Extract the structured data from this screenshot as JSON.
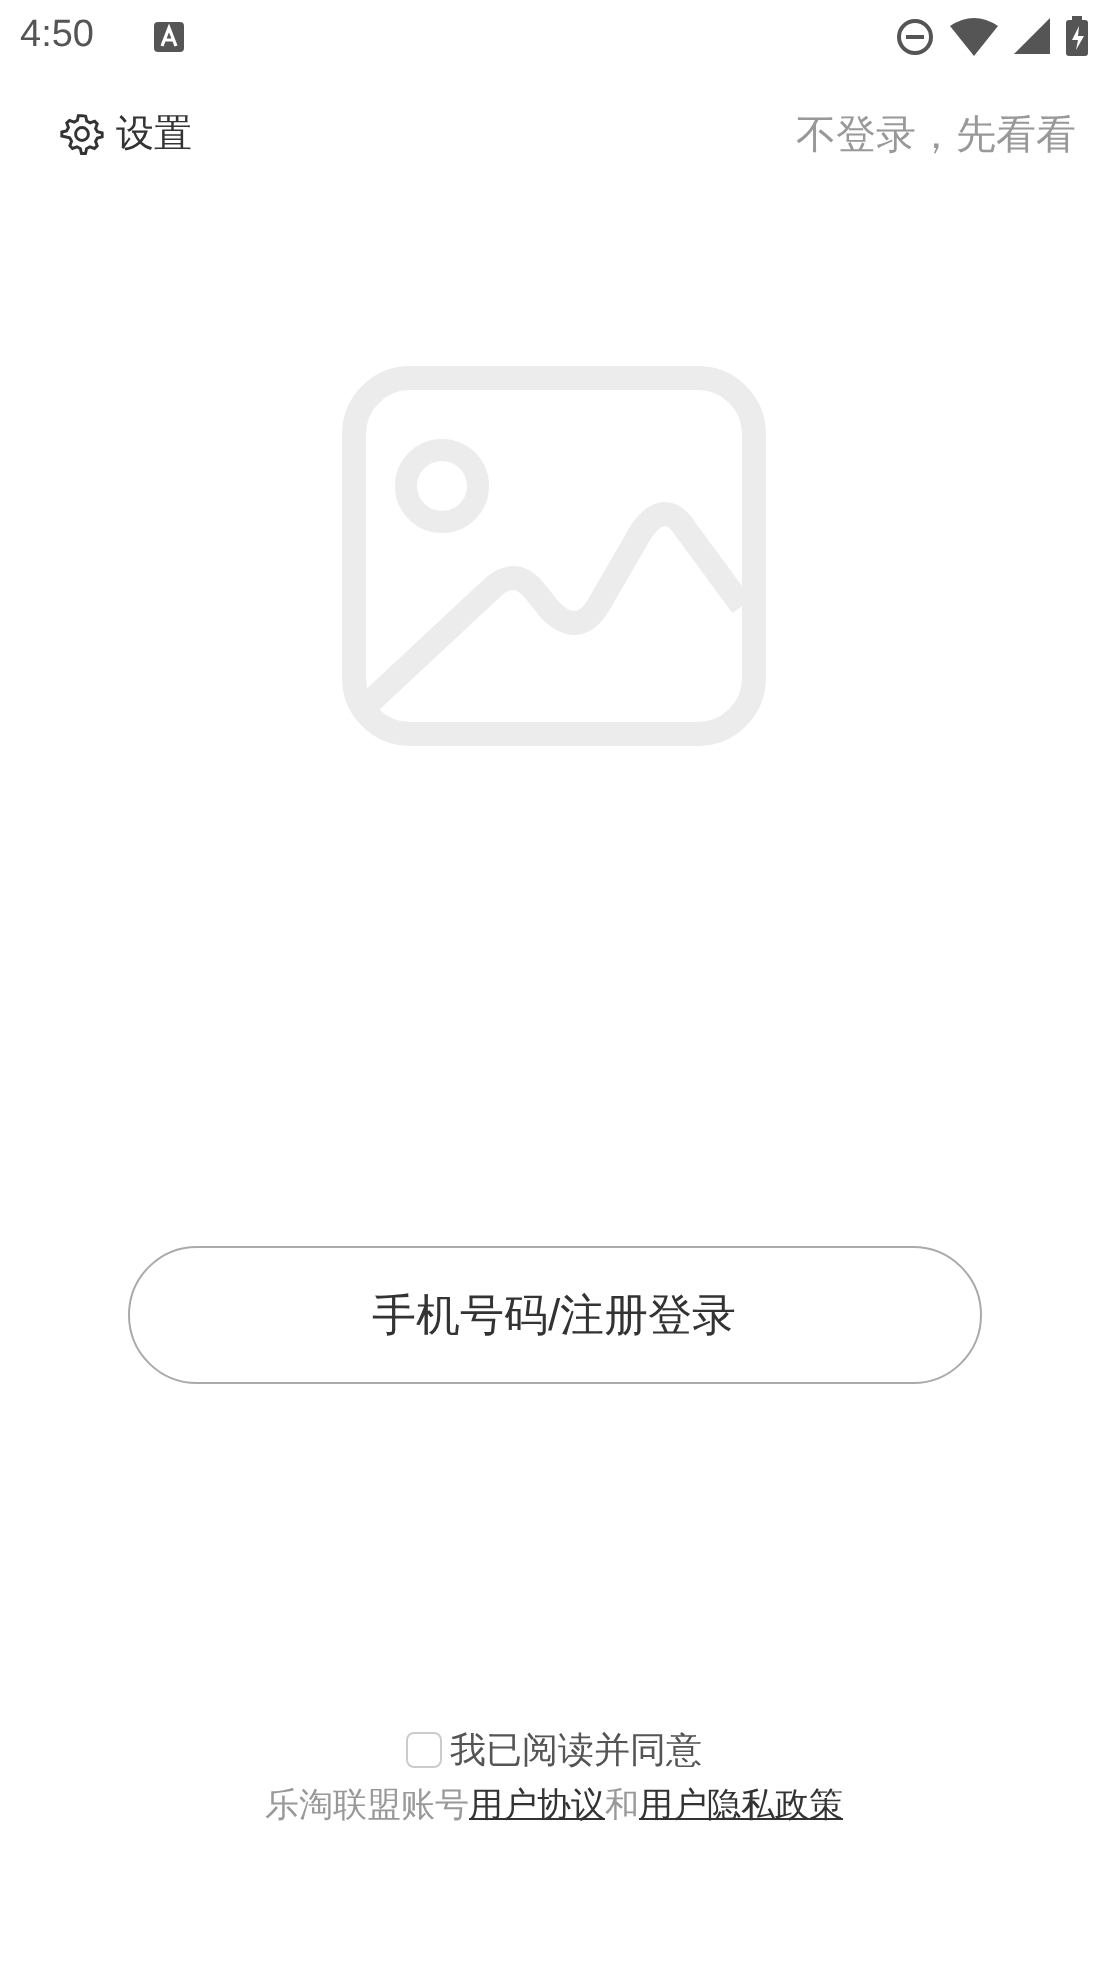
{
  "status_bar": {
    "time": "4:50"
  },
  "top_bar": {
    "settings_label": "设置",
    "skip_link": "不登录，先看看"
  },
  "login_button": "手机号码/注册登录",
  "agreement": {
    "checked": false,
    "label": "我已阅读并同意",
    "prefix": "乐淘联盟账号",
    "link_1": "用户协议",
    "joiner": "和",
    "link_2": "用户隐私政策"
  }
}
